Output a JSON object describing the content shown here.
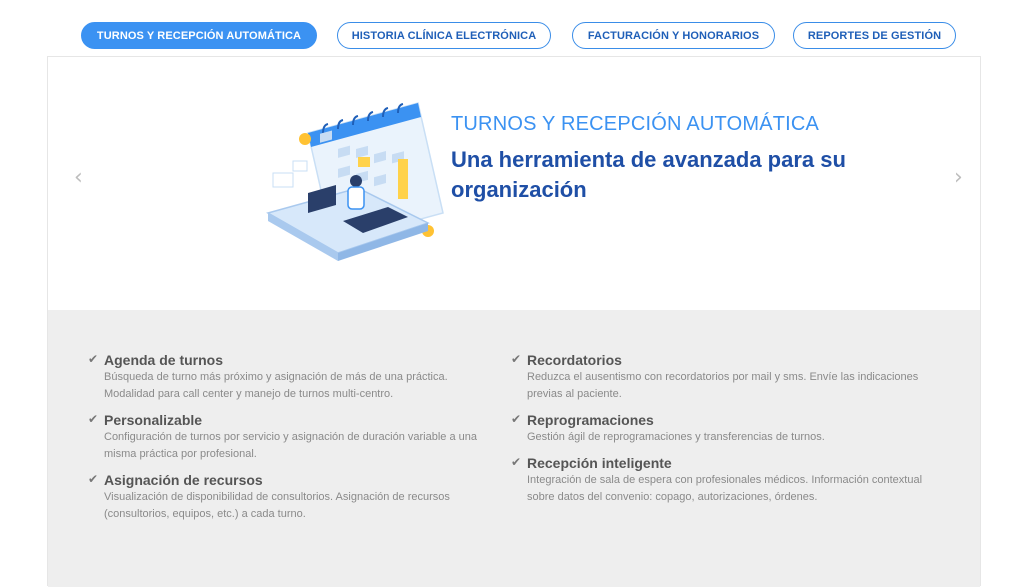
{
  "tabs": [
    {
      "label": "TURNOS Y RECEPCIÓN AUTOMÁTICA",
      "active": true
    },
    {
      "label": "HISTORIA CLÍNICA ELECTRÓNICA",
      "active": false
    },
    {
      "label": "FACTURACIÓN Y HONORARIOS",
      "active": false
    },
    {
      "label": "REPORTES DE GESTIÓN",
      "active": false
    }
  ],
  "carousel": {
    "prev_glyph": "‹",
    "next_glyph": "›",
    "subtitle": "TURNOS Y RECEPCIÓN AUTOMÁTICA",
    "title": "Una herramienta de avanzada para su organización",
    "illustration_icon": "calendar-doctor-illustration"
  },
  "features": {
    "check_glyph": "✔",
    "left": [
      {
        "title": "Agenda de turnos",
        "desc": "Búsqueda de turno más próximo y asignación de más de una práctica. Modalidad para call center y manejo de turnos multi-centro."
      },
      {
        "title": "Personalizable",
        "desc": "Configuración de turnos por servicio y asignación de duración variable a una misma práctica por profesional."
      },
      {
        "title": "Asignación de recursos",
        "desc": "Visualización de disponibilidad de consultorios. Asignación de recursos (consultorios, equipos, etc.) a cada turno."
      }
    ],
    "right": [
      {
        "title": "Recordatorios",
        "desc": "Reduzca el ausentismo con recordatorios por mail y sms. Envíe las indicaciones previas al paciente."
      },
      {
        "title": "Reprogramaciones",
        "desc": "Gestión ágil de reprogramaciones y transferencias de turnos."
      },
      {
        "title": "Recepción inteligente",
        "desc": "Integración de sala de espera con profesionales médicos. Información contextual sobre datos del convenio: copago, autorizaciones, órdenes."
      }
    ]
  },
  "colors": {
    "accent": "#3b92f2",
    "title": "#1f4fa6",
    "feature_bg": "#eeeeee"
  }
}
